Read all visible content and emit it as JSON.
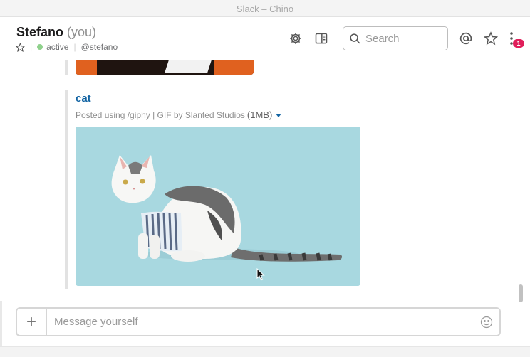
{
  "window": {
    "title": "Slack – Chino"
  },
  "header": {
    "name": "Stefano",
    "you_tag": "(you)",
    "status": "active",
    "handle": "@stefano",
    "search_placeholder": "Search",
    "notification_count": "1"
  },
  "message": {
    "attachment": {
      "title": "cat",
      "meta": "Posted using /giphy | GIF by Slanted Studios",
      "size": "(1MB)"
    }
  },
  "composer": {
    "placeholder": "Message yourself"
  },
  "icons": [
    "star-icon",
    "gear-icon",
    "details-panel-icon",
    "search-icon",
    "mentions-at-icon",
    "starred-items-icon",
    "more-vertical-icon",
    "plus-icon",
    "emoji-icon",
    "cursor-icon"
  ],
  "colors": {
    "link": "#1264a3",
    "active": "#8fd18c",
    "badge": "#e01e5a",
    "gif_background": "#a8d8e0"
  }
}
